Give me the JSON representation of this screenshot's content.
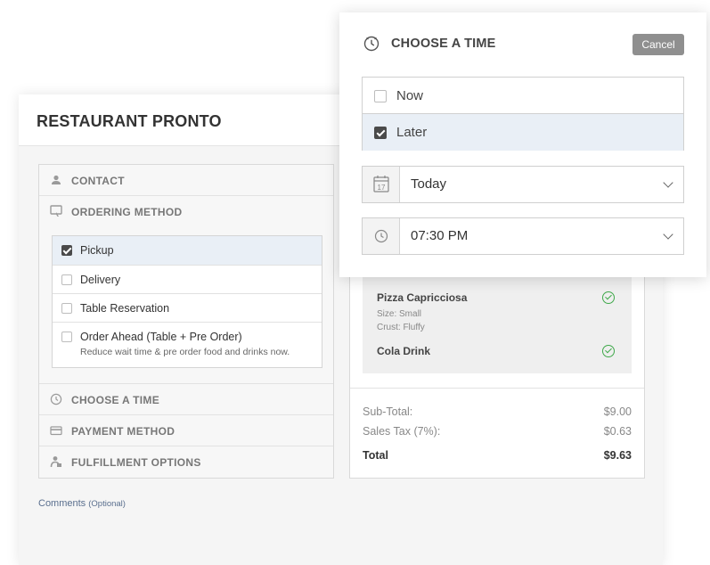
{
  "app": {
    "title": "RESTAURANT PRONTO"
  },
  "sections": {
    "contact": "CONTACT",
    "ordering_method": "ORDERING METHOD",
    "choose_time": "CHOOSE A TIME",
    "payment_method": "PAYMENT METHOD",
    "fulfillment_options": "FULFILLMENT OPTIONS"
  },
  "ordering_options": [
    {
      "label": "Pickup",
      "checked": true
    },
    {
      "label": "Delivery",
      "checked": false
    },
    {
      "label": "Table Reservation",
      "checked": false
    },
    {
      "label": "Order Ahead (Table + Pre Order)",
      "sub": "Reduce wait time & pre order food and drinks now.",
      "checked": false
    }
  ],
  "comments": {
    "label": "Comments",
    "optional": "(Optional)"
  },
  "order": {
    "items": [
      {
        "name": "Pizza Capricciosa",
        "details": [
          "Size: Small",
          "Crust: Fluffy"
        ],
        "confirmed": true
      },
      {
        "name": "Cola Drink",
        "details": [],
        "confirmed": true
      }
    ],
    "subtotal_label": "Sub-Total:",
    "subtotal": "$9.00",
    "tax_label": "Sales Tax (7%):",
    "tax": "$0.63",
    "total_label": "Total",
    "total": "$9.63"
  },
  "time_popup": {
    "title": "CHOOSE A TIME",
    "cancel": "Cancel",
    "options": [
      {
        "label": "Now",
        "checked": false
      },
      {
        "label": "Later",
        "checked": true
      }
    ],
    "day": "Today",
    "calendar_day": "17",
    "time": "07:30 PM"
  },
  "colors": {
    "selected_row": "#e9eff6",
    "check_green": "#3fa84a",
    "cancel_bg": "#8f8f8f"
  }
}
